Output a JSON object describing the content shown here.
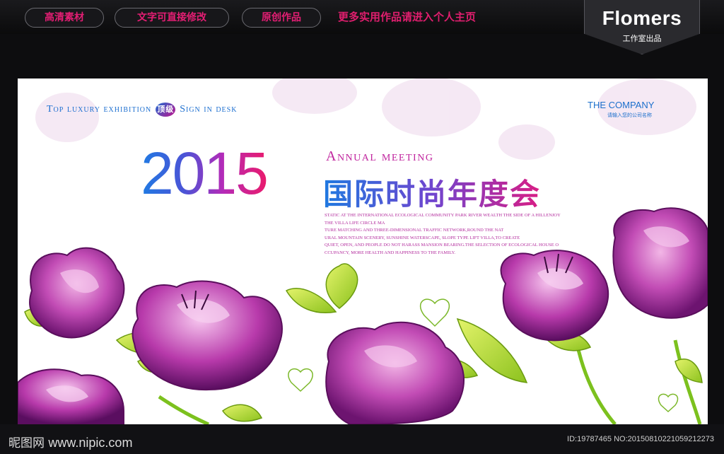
{
  "topbar": {
    "pills": [
      "高清素材",
      "文字可直接修改",
      "原创作品"
    ],
    "note": "更多实用作品请进入个人主页",
    "brand_name": "Flomers",
    "brand_sub": "工作室出品"
  },
  "poster": {
    "tagline_left": "Top luxury exhibition",
    "tagline_badge": "顶级",
    "tagline_right": "Sign in desk",
    "company": "THE COMPANY",
    "company_sub": "请输入您的公司名称",
    "year": "2015",
    "annual": "Annual meeting",
    "title_cn": "国际时尚年度会",
    "body_lines": [
      "STATIC AT THE INTERNATIONAL ECOLOGICAL COMMUNITY PARK RIVER WEALTH THE SIDE OF A HILLENJOY",
      "THE VILLA LIFE CIRCLE MA",
      "TURE MATCHING AND THREE-DIMENSIONAL TRAFFIC NETWORK,ROUND THE NAT",
      "URAL MOUNTAIN SCENERY, SUNSHINE WATERSCAPE, SLOPE TYPE LIFT VILLA,TO CREATE",
      "QUIET, OPEN, AND PEOPLE DO NOT HARASS MANSION BEARING.THE SELECTION OF ECOLOGICAL HOUSE O",
      "CCUPANCY, MORE HEALTH AND HAPPINESS TO THE FAMILY."
    ],
    "colors": {
      "blue": "#1f7be3",
      "magenta": "#c0249e",
      "pink": "#ea1a6b",
      "flower": "#a0248f",
      "leaf": "#b5d832"
    }
  },
  "footer": {
    "site_cn": "昵图网",
    "site_url": "www.nipic.com",
    "image_id": "ID:19787465 NO:20150810221059212273"
  }
}
